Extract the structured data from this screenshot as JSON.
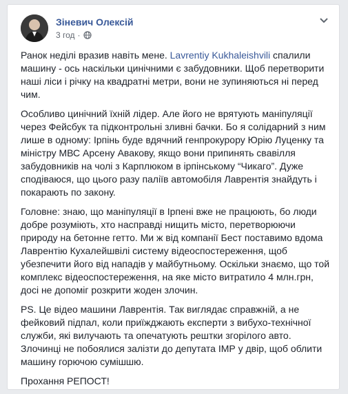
{
  "post": {
    "author": "Зіневич Олексій",
    "time": "3 год",
    "separator": "·",
    "privacy_icon": "globe-icon",
    "menu_icon": "chevron-down-icon",
    "accent_color": "#385898",
    "text_color": "#1d2129"
  },
  "body": {
    "p1": {
      "l1a": "Ранок неділі вразив навіть мене. ",
      "l1link": "Lavrentiy Kukhaleishvili",
      "l1b": " спалили",
      "l2": "машину - ось наскільки цинічними є забудовники. Щоб перетворити",
      "l3": "наші ліси і річку на квадратні метри, вони не зупиняються ні перед",
      "l4": "чим."
    },
    "p2": {
      "l1": "Особливо цинічний їхній лідер. Але його не врятують маніпуляції",
      "l2": "через Фейсбук та підконтрольні зливні бачки. Бо я солідарний з ним",
      "l3": "лише в одному: Ірпінь буде вдячний генпрокурору Юрію Луценку та",
      "l4": "міністру МВС Арсену Авакову, якщо вони припинять свавілля",
      "l5": "забудовників на чолі з Карплюком в ірпінському “Чикаго”. Дуже",
      "l6": "сподіваюся, що цього разу паліїв автомобіля Лаврентія знайдуть і",
      "l7": "покарають по закону."
    },
    "p3": {
      "l1": "Головне: знаю, що маніпуляції в Ірпені вже не працюють, бо люди",
      "l2": "добре розуміють, хто насправді нищить місто, перетворюючи",
      "l3": "природу на бетонне гетто. Ми ж від компанії Бест поставимо вдома",
      "l4": "Лаврентію Кухалейшвілі систему відеоспостереження, щоб",
      "l5": "убезпечити його від нападів у майбутньому. Оскільки знаємо, що той",
      "l6": "комплекс відеоспостереження, на яке місто витратило 4 млн.грн,",
      "l7": "досі не допоміг розкрити жоден злочин."
    },
    "p4": {
      "l1": "PS. Це відео машини Лаврентія. Так виглядає справжній, а не",
      "l2": "фейковий підпал, коли приїжджають експерти з вибухо-технічної",
      "l3": "служби, які вилучають та опечатують рештки згорілого авто.",
      "l4": "Злочинці не побоялися залізти до депутата ІМР у двір, щоб облити",
      "l5": "машину горючою сумішшю."
    },
    "p5": {
      "l1": "Прохання РЕПОСТ!"
    }
  }
}
